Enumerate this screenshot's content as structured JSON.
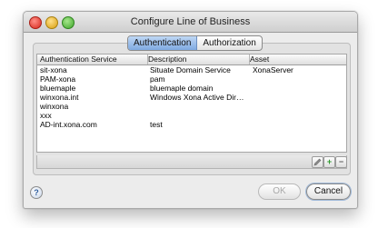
{
  "window": {
    "title": "Configure Line of Business"
  },
  "tabs": [
    {
      "label": "Authentication",
      "active": true
    },
    {
      "label": "Authorization",
      "active": false
    }
  ],
  "table": {
    "columns": [
      "Authentication Service",
      "Description",
      "Asset"
    ],
    "rows": [
      [
        "sit-xona",
        "Situate Domain Service",
        "XonaServer"
      ],
      [
        "PAM-xona",
        "pam",
        ""
      ],
      [
        "bluemaple",
        "bluemaple domain",
        ""
      ],
      [
        "winxona.int",
        "Windows Xona Active Dir…",
        ""
      ],
      [
        "winxona",
        "",
        ""
      ],
      [
        "xxx",
        "",
        ""
      ],
      [
        "AD-int.xona.com",
        "test",
        ""
      ]
    ]
  },
  "toolbar": {
    "edit_icon": "pencil-icon",
    "add_icon": "plus-icon",
    "remove_icon": "minus-icon",
    "add_glyph": "+",
    "remove_glyph": "−"
  },
  "footer": {
    "help_glyph": "?",
    "ok_label": "OK",
    "cancel_label": "Cancel"
  },
  "colors": {
    "tab_active": "#7fa9e1",
    "add_green": "#2f9a2f",
    "close_red": "#d6261b"
  }
}
